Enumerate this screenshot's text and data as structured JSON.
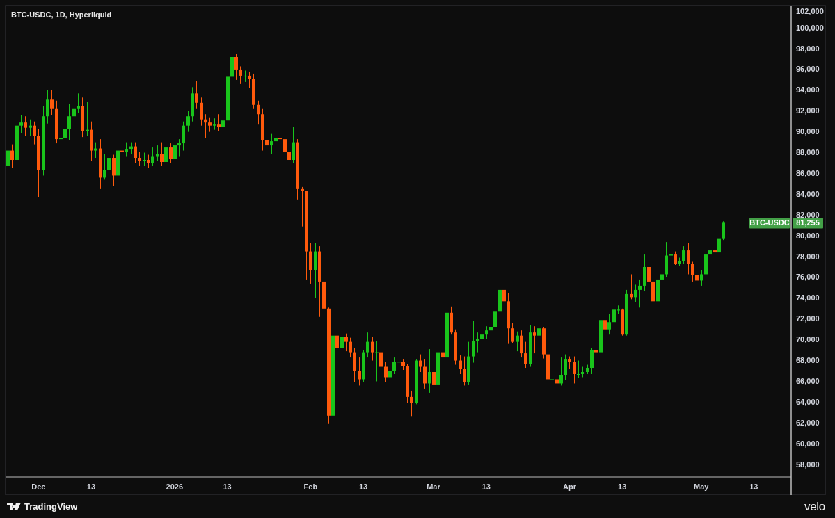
{
  "chart": {
    "title": "BTC-USDC, 1D, Hyperliquid",
    "chart_data": {
      "type": "candlestick",
      "ylim": [
        56800,
        102150
      ],
      "categories": [
        null,
        null,
        null,
        null,
        null,
        null,
        null,
        "Dec",
        null,
        null,
        null,
        null,
        null,
        null,
        null,
        null,
        null,
        null,
        null,
        "13",
        null,
        null,
        null,
        null,
        null,
        null,
        null,
        null,
        null,
        null,
        null,
        null,
        null,
        null,
        null,
        null,
        null,
        null,
        "2026",
        null,
        null,
        null,
        null,
        null,
        null,
        null,
        null,
        null,
        null,
        null,
        "13",
        null,
        null,
        null,
        null,
        null,
        null,
        null,
        null,
        null,
        null,
        null,
        null,
        null,
        null,
        null,
        null,
        null,
        null,
        "Feb",
        null,
        null,
        null,
        null,
        null,
        null,
        null,
        null,
        null,
        null,
        null,
        "13",
        null,
        null,
        null,
        null,
        null,
        null,
        null,
        null,
        null,
        null,
        null,
        null,
        null,
        null,
        null,
        "Mar",
        null,
        null,
        null,
        null,
        null,
        null,
        null,
        null,
        null,
        null,
        null,
        "13",
        null,
        null,
        null,
        null,
        null,
        null,
        null,
        null,
        null,
        null,
        null,
        null,
        null,
        null,
        null,
        null,
        null,
        null,
        "Apr",
        null,
        null,
        null,
        null,
        null,
        null,
        null,
        null,
        null,
        null,
        null,
        "13",
        null,
        null,
        null,
        null,
        null,
        null,
        null,
        null,
        null,
        null,
        null,
        null,
        null,
        null,
        null,
        null,
        null,
        "May",
        null,
        null,
        null,
        null,
        null,
        null,
        null,
        null,
        null,
        null,
        null,
        "13",
        null,
        null,
        null,
        null,
        null,
        null,
        null,
        null
      ],
      "ohlc": [
        [
          86700,
          89200,
          85400,
          88200
        ],
        [
          88200,
          88800,
          86500,
          87300
        ],
        [
          87300,
          91100,
          86800,
          90600
        ],
        [
          90600,
          91600,
          89900,
          90900
        ],
        [
          90900,
          91500,
          89600,
          90400
        ],
        [
          90400,
          91200,
          89600,
          90600
        ],
        [
          90600,
          91000,
          88800,
          89600
        ],
        [
          89600,
          90300,
          83700,
          86300
        ],
        [
          86300,
          92500,
          85800,
          91500
        ],
        [
          91500,
          94000,
          90800,
          93100
        ],
        [
          93100,
          94000,
          91600,
          92200
        ],
        [
          92200,
          93000,
          88900,
          89300
        ],
        [
          89300,
          91000,
          88600,
          89400
        ],
        [
          89400,
          91000,
          89100,
          90300
        ],
        [
          90300,
          92700,
          89200,
          91500
        ],
        [
          91500,
          94400,
          90500,
          92200
        ],
        [
          92200,
          93700,
          91800,
          92500
        ],
        [
          92500,
          93300,
          89500,
          90100
        ],
        [
          90100,
          92900,
          89600,
          90200
        ],
        [
          90200,
          91000,
          87200,
          88200
        ],
        [
          88200,
          89000,
          87500,
          88400
        ],
        [
          88400,
          89300,
          84500,
          85600
        ],
        [
          85600,
          87900,
          85400,
          86300
        ],
        [
          86300,
          88200,
          85800,
          87500
        ],
        [
          87500,
          87800,
          84800,
          85800
        ],
        [
          85800,
          88700,
          85200,
          88200
        ],
        [
          88200,
          88600,
          87600,
          88100
        ],
        [
          88100,
          89000,
          87600,
          88300
        ],
        [
          88300,
          89000,
          87900,
          88600
        ],
        [
          88600,
          89000,
          87000,
          87500
        ],
        [
          87500,
          88100,
          86700,
          87200
        ],
        [
          87200,
          88000,
          86700,
          87300
        ],
        [
          87300,
          87800,
          86500,
          87000
        ],
        [
          87000,
          88500,
          86700,
          87600
        ],
        [
          87600,
          88700,
          87200,
          87900
        ],
        [
          87900,
          89000,
          86700,
          87100
        ],
        [
          87100,
          89200,
          86600,
          88500
        ],
        [
          88500,
          88900,
          87000,
          87400
        ],
        [
          87400,
          89600,
          86900,
          88700
        ],
        [
          88700,
          89300,
          87600,
          88900
        ],
        [
          88900,
          91000,
          88200,
          90600
        ],
        [
          90600,
          92000,
          90000,
          91500
        ],
        [
          91500,
          94300,
          91000,
          93700
        ],
        [
          93700,
          94900,
          92200,
          92800
        ],
        [
          92800,
          93300,
          90600,
          91200
        ],
        [
          91200,
          91700,
          89400,
          90900
        ],
        [
          90900,
          91400,
          90000,
          90600
        ],
        [
          90600,
          91300,
          90200,
          90700
        ],
        [
          90700,
          91700,
          90100,
          90500
        ],
        [
          90500,
          92300,
          90000,
          91100
        ],
        [
          91100,
          96500,
          90600,
          95300
        ],
        [
          95300,
          97900,
          95000,
          97200
        ],
        [
          97200,
          97500,
          95000,
          96000
        ],
        [
          96000,
          96300,
          94600,
          95400
        ],
        [
          95400,
          95900,
          94800,
          95400
        ],
        [
          95400,
          95800,
          94200,
          95100
        ],
        [
          95100,
          95600,
          92200,
          92600
        ],
        [
          92600,
          93000,
          90700,
          91700
        ],
        [
          91700,
          92200,
          88200,
          89200
        ],
        [
          89200,
          89800,
          87800,
          88700
        ],
        [
          88700,
          89800,
          87900,
          89100
        ],
        [
          89100,
          90600,
          88500,
          89400
        ],
        [
          89400,
          90100,
          88600,
          89300
        ],
        [
          89300,
          89600,
          87600,
          88100
        ],
        [
          88100,
          88500,
          86900,
          87300
        ],
        [
          87300,
          90500,
          87000,
          89000
        ],
        [
          89000,
          89300,
          83500,
          84500
        ],
        [
          84500,
          84700,
          80900,
          84300
        ],
        [
          84300,
          84300,
          75800,
          78500
        ],
        [
          78500,
          79300,
          75400,
          76700
        ],
        [
          76700,
          79300,
          74000,
          78500
        ],
        [
          78500,
          79000,
          72200,
          75600
        ],
        [
          75600,
          76800,
          71300,
          73000
        ],
        [
          73000,
          73100,
          61900,
          62700
        ],
        [
          62700,
          70900,
          59900,
          70400
        ],
        [
          70400,
          70900,
          67300,
          69200
        ],
        [
          69200,
          71000,
          68400,
          70300
        ],
        [
          70300,
          70600,
          68900,
          69800
        ],
        [
          69800,
          70200,
          68300,
          68800
        ],
        [
          68800,
          69200,
          65900,
          67000
        ],
        [
          67000,
          68300,
          65600,
          66200
        ],
        [
          66200,
          69000,
          65900,
          68800
        ],
        [
          68800,
          70700,
          68300,
          69800
        ],
        [
          69800,
          70300,
          68000,
          68800
        ],
        [
          68800,
          69900,
          66000,
          68800
        ],
        [
          68800,
          69300,
          66700,
          67400
        ],
        [
          67400,
          67900,
          65900,
          66400
        ],
        [
          66400,
          67300,
          65900,
          67000
        ],
        [
          67000,
          68300,
          66700,
          67900
        ],
        [
          67900,
          68400,
          67500,
          67900
        ],
        [
          67900,
          68100,
          67100,
          67500
        ],
        [
          67500,
          67700,
          63900,
          64500
        ],
        [
          64500,
          65100,
          62600,
          63900
        ],
        [
          63900,
          68100,
          63800,
          68000
        ],
        [
          68000,
          68600,
          66900,
          67400
        ],
        [
          67400,
          68100,
          65300,
          65800
        ],
        [
          65800,
          69100,
          64900,
          66900
        ],
        [
          66900,
          69500,
          65000,
          65700
        ],
        [
          65700,
          69900,
          65600,
          68800
        ],
        [
          68800,
          69200,
          66000,
          68300
        ],
        [
          68300,
          73400,
          67300,
          72600
        ],
        [
          72600,
          73200,
          70500,
          70700
        ],
        [
          70700,
          71000,
          67600,
          68000
        ],
        [
          68000,
          68500,
          66700,
          67200
        ],
        [
          67200,
          68400,
          65600,
          65900
        ],
        [
          65900,
          69800,
          65700,
          68400
        ],
        [
          68400,
          71800,
          67800,
          69900
        ],
        [
          69900,
          70700,
          68800,
          70100
        ],
        [
          70100,
          71000,
          68500,
          70500
        ],
        [
          70500,
          71300,
          70100,
          70900
        ],
        [
          70900,
          71500,
          70000,
          71200
        ],
        [
          71200,
          73100,
          70900,
          72700
        ],
        [
          72700,
          75000,
          72100,
          74800
        ],
        [
          74800,
          75800,
          73000,
          73700
        ],
        [
          73700,
          74500,
          69600,
          71100
        ],
        [
          71100,
          71600,
          69700,
          69800
        ],
        [
          69800,
          70800,
          68900,
          70400
        ],
        [
          70400,
          70900,
          68300,
          68700
        ],
        [
          68700,
          69800,
          67300,
          67700
        ],
        [
          67700,
          71400,
          67400,
          70700
        ],
        [
          70700,
          71300,
          68700,
          70400
        ],
        [
          70400,
          71900,
          69300,
          71100
        ],
        [
          71100,
          71200,
          68200,
          68600
        ],
        [
          68600,
          69200,
          65700,
          66200
        ],
        [
          66200,
          67100,
          65800,
          66200
        ],
        [
          66200,
          67800,
          65000,
          65800
        ],
        [
          65800,
          68300,
          65600,
          66600
        ],
        [
          66600,
          68600,
          66100,
          68100
        ],
        [
          68100,
          68400,
          67200,
          67900
        ],
        [
          67900,
          68400,
          65800,
          66700
        ],
        [
          66700,
          68000,
          66300,
          66700
        ],
        [
          66700,
          67400,
          66400,
          66900
        ],
        [
          66900,
          67600,
          66700,
          67300
        ],
        [
          67300,
          69200,
          66700,
          69000
        ],
        [
          69000,
          70300,
          68200,
          68800
        ],
        [
          68800,
          72500,
          67800,
          71900
        ],
        [
          71900,
          72700,
          70700,
          71000
        ],
        [
          71000,
          72500,
          70500,
          71700
        ],
        [
          71700,
          73400,
          71600,
          72900
        ],
        [
          72900,
          73300,
          72500,
          72900
        ],
        [
          72900,
          73000,
          70400,
          70500
        ],
        [
          70500,
          74800,
          70400,
          74400
        ],
        [
          74400,
          76300,
          73900,
          74100
        ],
        [
          74100,
          75300,
          73600,
          74800
        ],
        [
          74800,
          75800,
          73100,
          75200
        ],
        [
          75200,
          78200,
          74700,
          77000
        ],
        [
          77000,
          77200,
          75400,
          75600
        ],
        [
          75600,
          76200,
          73700,
          73700
        ],
        [
          73700,
          76500,
          73700,
          75800
        ],
        [
          75800,
          76800,
          74900,
          76300
        ],
        [
          76300,
          79400,
          76000,
          78100
        ],
        [
          78100,
          78700,
          77100,
          78200
        ],
        [
          78200,
          78500,
          77200,
          77300
        ],
        [
          77300,
          77900,
          77100,
          77600
        ],
        [
          77600,
          79000,
          77300,
          78600
        ],
        [
          78600,
          79300,
          76300,
          77300
        ],
        [
          77300,
          77500,
          75600,
          76200
        ],
        [
          76200,
          77500,
          74800,
          75700
        ],
        [
          75700,
          76700,
          75200,
          76300
        ],
        [
          76300,
          78900,
          76100,
          78200
        ],
        [
          78200,
          79000,
          77900,
          78600
        ],
        [
          78600,
          79300,
          78000,
          78400
        ],
        [
          78400,
          80800,
          78100,
          79700
        ],
        [
          79700,
          81400,
          79600,
          81255
        ],
        null,
        null,
        null,
        null,
        null,
        null,
        null,
        null,
        null,
        null,
        null,
        null,
        null,
        null,
        null
      ],
      "yticks": [
        {
          "value": 58000,
          "label": "58,000"
        },
        {
          "value": 60000,
          "label": "60,000"
        },
        {
          "value": 62000,
          "label": "62,000"
        },
        {
          "value": 64000,
          "label": "64,000"
        },
        {
          "value": 66000,
          "label": "66,000"
        },
        {
          "value": 68000,
          "label": "68,000"
        },
        {
          "value": 70000,
          "label": "70,000"
        },
        {
          "value": 72000,
          "label": "72,000"
        },
        {
          "value": 74000,
          "label": "74,000"
        },
        {
          "value": 76000,
          "label": "76,000"
        },
        {
          "value": 78000,
          "label": "78,000"
        },
        {
          "value": 80000,
          "label": "80,000"
        },
        {
          "value": 82000,
          "label": "82,000"
        },
        {
          "value": 84000,
          "label": "84,000"
        },
        {
          "value": 86000,
          "label": "86,000"
        },
        {
          "value": 88000,
          "label": "88,000"
        },
        {
          "value": 90000,
          "label": "90,000"
        },
        {
          "value": 92000,
          "label": "92,000"
        },
        {
          "value": 94000,
          "label": "94,000"
        },
        {
          "value": 96000,
          "label": "96,000"
        },
        {
          "value": 98000,
          "label": "98,000"
        },
        {
          "value": 100000,
          "label": "100,000"
        },
        {
          "value": 102000,
          "label": "102,000"
        }
      ]
    },
    "last_price": {
      "symbol_label": "BTC-USDC",
      "value_label": "81,255"
    }
  },
  "footer": {
    "brand": "TradingView",
    "site": "velo"
  }
}
